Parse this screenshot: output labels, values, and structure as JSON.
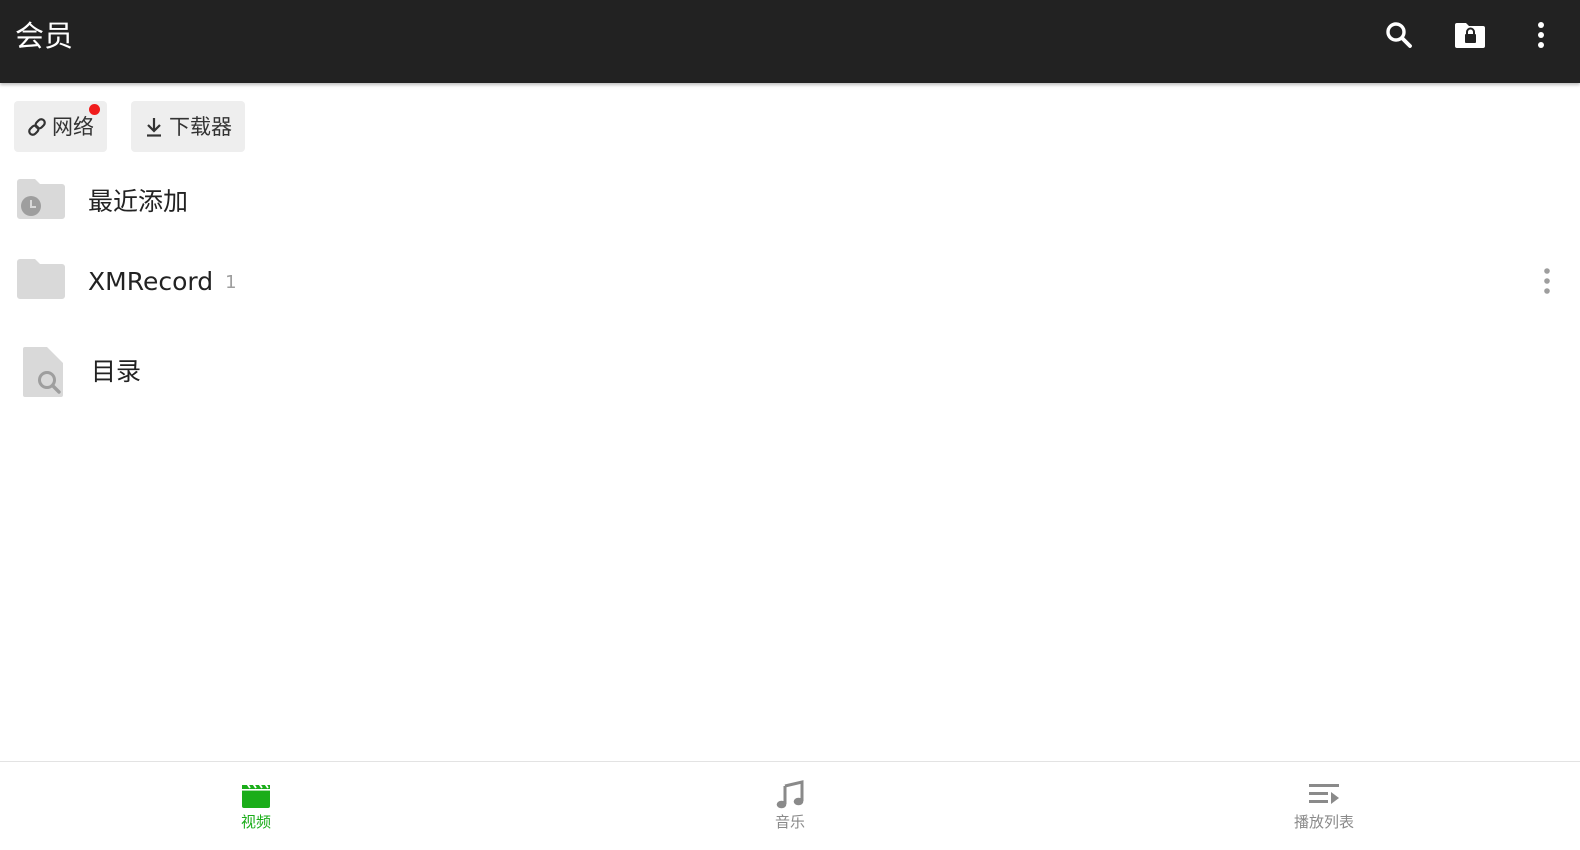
{
  "header": {
    "title": "会员",
    "actions": [
      {
        "name": "search-icon"
      },
      {
        "name": "lock-folder-icon"
      },
      {
        "name": "more-vert-icon"
      }
    ]
  },
  "chips": [
    {
      "label": "网络",
      "icon": "link-icon",
      "has_notification": true
    },
    {
      "label": "下载器",
      "icon": "download-icon"
    }
  ],
  "list": {
    "recent": {
      "label": "最近添加",
      "icon": "recent-folder-icon"
    },
    "folder": {
      "label": "XMRecord",
      "count": "1",
      "icon": "folder-icon"
    },
    "catalog": {
      "label": "目录",
      "icon": "file-search-icon"
    }
  },
  "bottom_nav": [
    {
      "label": "视频",
      "icon": "clapperboard-icon",
      "active": true
    },
    {
      "label": "音乐",
      "icon": "music-note-icon",
      "active": false
    },
    {
      "label": "播放列表",
      "icon": "playlist-icon",
      "active": false
    }
  ],
  "colors": {
    "appbar": "#222222",
    "accent": "#1aad19",
    "inactive": "#8a8a8a",
    "notification": "#f01c1c",
    "chip_bg": "#eeeeee",
    "folder": "#d9d9d9"
  }
}
